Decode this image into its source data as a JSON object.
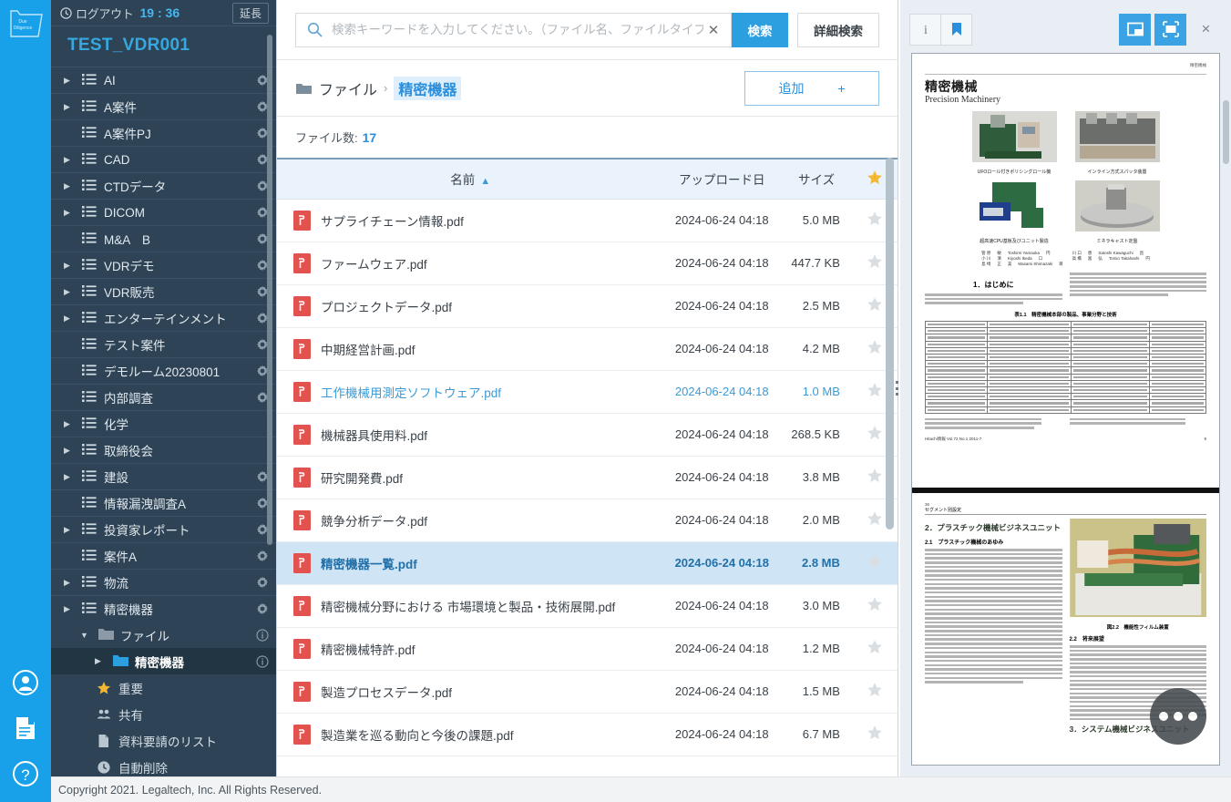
{
  "rail": {
    "logo_text_line1": "Due",
    "logo_text_line2": "Diligence",
    "icons": [
      {
        "name": "account-icon"
      },
      {
        "name": "document-save-icon"
      },
      {
        "name": "help-icon"
      }
    ]
  },
  "sidebar": {
    "logout_label": "ログアウト",
    "logout_time": "19 : 36",
    "extend_label": "延長",
    "vdr_title": "TEST_VDR001",
    "items": [
      {
        "label": "AI",
        "twisty": "closed",
        "gear": true
      },
      {
        "label": "A案件",
        "twisty": "closed",
        "gear": true
      },
      {
        "label": "A案件PJ",
        "twisty": "none",
        "gear": true
      },
      {
        "label": "CAD",
        "twisty": "closed",
        "gear": true
      },
      {
        "label": "CTDデータ",
        "twisty": "closed",
        "gear": true
      },
      {
        "label": "DICOM",
        "twisty": "closed",
        "gear": true
      },
      {
        "label": "M&A　B",
        "twisty": "none",
        "gear": true
      },
      {
        "label": "VDRデモ",
        "twisty": "closed",
        "gear": true
      },
      {
        "label": "VDR販売",
        "twisty": "closed",
        "gear": true
      },
      {
        "label": "エンターテインメント",
        "twisty": "closed",
        "gear": true
      },
      {
        "label": "テスト案件",
        "twisty": "none",
        "gear": true
      },
      {
        "label": "デモルーム20230801",
        "twisty": "none",
        "gear": true
      },
      {
        "label": "内部調査",
        "twisty": "none",
        "gear": true
      },
      {
        "label": "化学",
        "twisty": "closed",
        "gear": false
      },
      {
        "label": "取締役会",
        "twisty": "closed",
        "gear": false
      },
      {
        "label": "建設",
        "twisty": "closed",
        "gear": true
      },
      {
        "label": "情報漏洩調査A",
        "twisty": "none",
        "gear": true
      },
      {
        "label": "投資家レポート",
        "twisty": "closed",
        "gear": true
      },
      {
        "label": "案件A",
        "twisty": "none",
        "gear": true
      },
      {
        "label": "物流",
        "twisty": "closed",
        "gear": true
      },
      {
        "label": "精密機器",
        "twisty": "closed",
        "gear": true
      }
    ],
    "sub_file_label": "ファイル",
    "sub_selected_label": "精密機器",
    "leaf_items": [
      {
        "label": "重要",
        "icon": "star-icon"
      },
      {
        "label": "共有",
        "icon": "people-icon"
      },
      {
        "label": "資料要請のリスト",
        "icon": "document-icon"
      },
      {
        "label": "自動削除",
        "icon": "clock-icon"
      }
    ]
  },
  "search": {
    "placeholder": "検索キーワードを入力してください。（ファイル名、ファイルタイプ）",
    "value": "",
    "search_button": "検索",
    "advanced_button": "詳細検索"
  },
  "breadcrumb": {
    "root": "ファイル",
    "separator": "›",
    "current": "精密機器",
    "add_button": "追加",
    "add_plus": "+"
  },
  "file_count": {
    "label": "ファイル数:",
    "value": "17"
  },
  "table": {
    "headers": {
      "name": "名前",
      "date": "アップロード日",
      "size": "サイズ",
      "star": "star-icon"
    },
    "sort_caret": "▲",
    "rows": [
      {
        "name": "サプライチェーン情報.pdf",
        "date": "2024-06-24 04:18",
        "size": "5.0 MB",
        "state": "normal"
      },
      {
        "name": "ファームウェア.pdf",
        "date": "2024-06-24 04:18",
        "size": "447.7 KB",
        "state": "normal"
      },
      {
        "name": "プロジェクトデータ.pdf",
        "date": "2024-06-24 04:18",
        "size": "2.5 MB",
        "state": "normal"
      },
      {
        "name": "中期経営計画.pdf",
        "date": "2024-06-24 04:18",
        "size": "4.2 MB",
        "state": "normal"
      },
      {
        "name": "工作機械用測定ソフトウェア.pdf",
        "date": "2024-06-24 04:18",
        "size": "1.0 MB",
        "state": "visited"
      },
      {
        "name": "機械器具使用料.pdf",
        "date": "2024-06-24 04:18",
        "size": "268.5 KB",
        "state": "normal"
      },
      {
        "name": "研究開発費.pdf",
        "date": "2024-06-24 04:18",
        "size": "3.8 MB",
        "state": "normal"
      },
      {
        "name": "競争分析データ.pdf",
        "date": "2024-06-24 04:18",
        "size": "2.0 MB",
        "state": "normal"
      },
      {
        "name": "精密機器一覧.pdf",
        "date": "2024-06-24 04:18",
        "size": "2.8 MB",
        "state": "selected"
      },
      {
        "name": "精密機械分野における 市場環境と製品・技術展開.pdf",
        "date": "2024-06-24 04:18",
        "size": "3.0 MB",
        "state": "normal"
      },
      {
        "name": "精密機械特許.pdf",
        "date": "2024-06-24 04:18",
        "size": "1.2 MB",
        "state": "normal"
      },
      {
        "name": "製造プロセスデータ.pdf",
        "date": "2024-06-24 04:18",
        "size": "1.5 MB",
        "state": "normal"
      },
      {
        "name": "製造業を巡る動向と今後の課題.pdf",
        "date": "2024-06-24 04:18",
        "size": "6.7 MB",
        "state": "normal"
      }
    ]
  },
  "preview": {
    "toolbar": {
      "info": "info-icon",
      "bookmark": "bookmark-icon",
      "panel_layout": "panel-layout-icon",
      "fit_screen": "fit-screen-icon",
      "close": "×"
    },
    "document": {
      "header_right": "精密機械",
      "title_ja": "精密機械",
      "title_en": "Precision Machinery",
      "photo_captions": [
        "UFOロール付きポリシングロール機",
        "インライン方式スパッタ装置",
        "超高速CPU基板及びユニット製造",
        "ミネラキャスト定盤"
      ],
      "authors": [
        "管 原 　 敏 　 Toshimi Yamaoka 　 円",
        "小 川 　 清 　 Kiyoshi Ikeda 　 口",
        "島 崎 　 正 　 美 　 Masami Shimazaki 　 目"
      ],
      "authors2": [
        "川 口 　 恵 　 Satoshi Kawaguchi 　 昌",
        "高 橋 　 富 　 弘 　 Tomio Takahashi 　 円"
      ],
      "section_1": "1．はじめに",
      "table_caption": "表1.1　精密機械本部の製品、事業分野と技術",
      "footer_left": "Hitachi情報 Vol.72 No.1 2011-7",
      "footer_right": "9"
    },
    "document2": {
      "page_num": "36",
      "header": "セグメント別設定",
      "section_2": "2．プラスチック機械ビジネスユニット",
      "sub_2_1": "2.1　プラスチック機械のあゆみ",
      "sub_2_2": "2.2　将来展望",
      "photo_caption": "図2.2　機能性フィルム装置",
      "section_3": "3．システム機械ビジネスユニット"
    }
  },
  "footer": {
    "copyright": "Copyright 2021. Legaltech, Inc. All Rights Reserved."
  },
  "colors": {
    "brand_blue": "#18a0e8",
    "sidebar_bg": "#2e4456",
    "accent": "#2b9fe0",
    "selected_row": "#cfe4f5",
    "pdf_red": "#e2524e",
    "star_gold": "#f5b731"
  }
}
